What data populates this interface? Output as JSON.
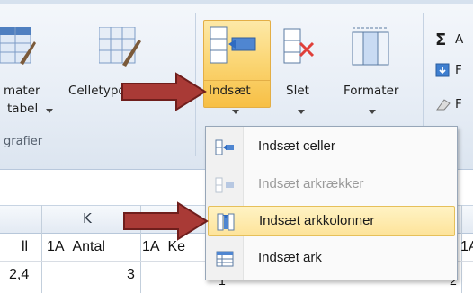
{
  "ribbon": {
    "styles_group": {
      "format_table_label_l1": "mater",
      "format_table_label_l2": "tabel",
      "cell_styles_label": "Celletypografi",
      "group_label": "grafier"
    },
    "cells_group": {
      "insert_label": "Indsæt",
      "delete_label": "Slet",
      "format_label": "Formater"
    },
    "editing_group": {
      "autosum_glyph": "Σ",
      "autosum_label": "A",
      "fill_label": "F",
      "clear_label": "F"
    }
  },
  "sheet": {
    "column_header": "K",
    "row1": [
      "ll",
      "1A_Antal",
      "1A_Ke",
      "1A"
    ],
    "row2": [
      "2,4",
      "3",
      "1",
      "2"
    ]
  },
  "insert_menu": {
    "items": [
      {
        "label": "Indsæt celler",
        "enabled": true
      },
      {
        "label": "Indsæt arkrækker",
        "enabled": false
      },
      {
        "label": "Indsæt arkkolonner",
        "enabled": true,
        "highlighted": true
      },
      {
        "label": "Indsæt ark",
        "enabled": true
      }
    ]
  },
  "colors": {
    "highlight": "#fde39a",
    "arrow": "#a93a36",
    "ribbon_bg": "#e8eef6"
  }
}
